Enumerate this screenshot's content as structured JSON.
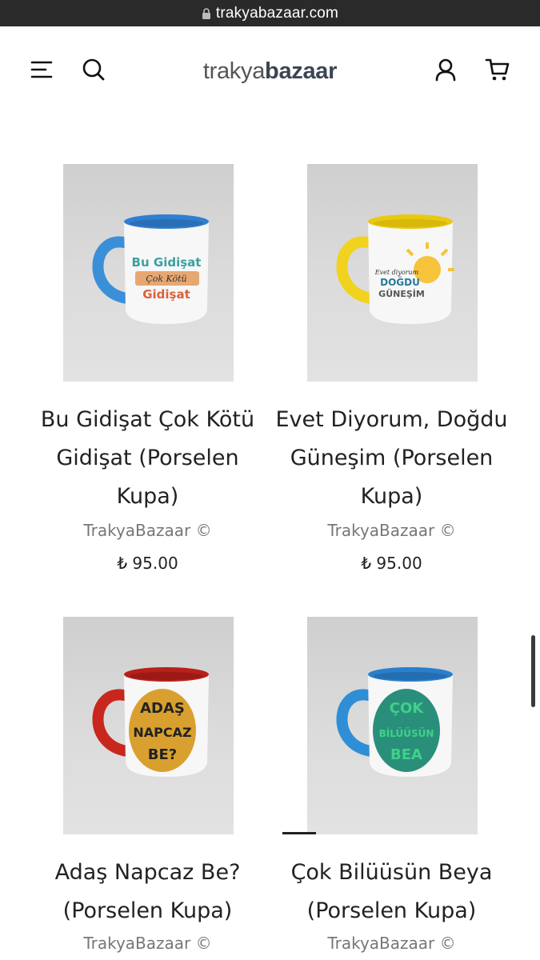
{
  "browser": {
    "url": "trakyabazaar.com"
  },
  "header": {
    "logo_part1": "trakya",
    "logo_part2": "bazaar",
    "icons": [
      "menu-icon",
      "search-icon",
      "account-icon",
      "cart-icon"
    ]
  },
  "products": [
    {
      "title": "Bu Gidişat Çok Kötü Gidişat (Porselen Kupa)",
      "brand": "TrakyaBazaar ©",
      "price": "₺ 95.00",
      "mug_print": [
        "Bu Gidişat",
        "Çok Kötü",
        "Gidişat"
      ],
      "handle_color": "#3a8fd8"
    },
    {
      "title": "Evet Diyorum, Doğdu Güneşim (Porselen Kupa)",
      "brand": "TrakyaBazaar ©",
      "price": "₺ 95.00",
      "mug_print": [
        "Evet diyorum",
        "DOĞDU",
        "GÜNEŞİM"
      ],
      "handle_color": "#f1d21e"
    },
    {
      "title": "Adaş Napcaz Be? (Porselen Kupa)",
      "brand": "TrakyaBazaar ©",
      "price": "",
      "mug_print": [
        "ADAŞ",
        "NAPCAZ",
        "BE?"
      ],
      "handle_color": "#c8271d"
    },
    {
      "title": "Çok Bilüüsün Beya (Porselen Kupa)",
      "brand": "TrakyaBazaar ©",
      "price": "",
      "mug_print": [
        "ÇOK",
        "BİLÜÜSÜN",
        "BEA"
      ],
      "handle_color": "#2f8fd6"
    }
  ],
  "colors": {
    "browser_bar": "#2a2a2a",
    "text": "#222222",
    "muted": "#777777"
  }
}
